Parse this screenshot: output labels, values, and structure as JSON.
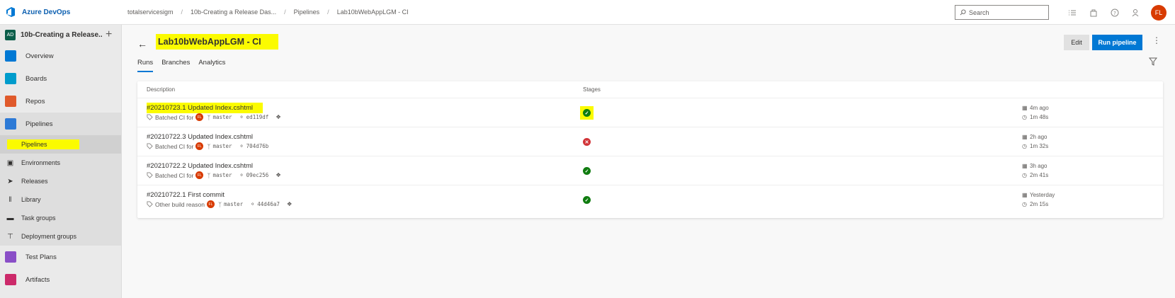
{
  "topbar": {
    "brand": "Azure DevOps",
    "breadcrumb": [
      "totalservicesigm",
      "10b-Creating a Release Das...",
      "Pipelines",
      "Lab10bWebAppLGM - CI"
    ],
    "search_placeholder": "Search",
    "user_initials": "FL"
  },
  "sidebar": {
    "project_badge": "AD",
    "project_name": "10b-Creating a Release...",
    "items": [
      {
        "label": "Overview",
        "color": "#0078d4"
      },
      {
        "label": "Boards",
        "color": "#009ccc"
      },
      {
        "label": "Repos",
        "color": "#e05a2b"
      },
      {
        "label": "Pipelines",
        "color": "#2d7ad6"
      }
    ],
    "sub_items": [
      "Pipelines",
      "Environments",
      "Releases",
      "Library",
      "Task groups",
      "Deployment groups"
    ],
    "bottom_items": [
      {
        "label": "Test Plans",
        "color": "#8a4fc7"
      },
      {
        "label": "Artifacts",
        "color": "#cc2a6a"
      }
    ]
  },
  "main": {
    "title": "Lab10bWebAppLGM - CI",
    "edit_label": "Edit",
    "run_label": "Run pipeline",
    "tabs": [
      "Runs",
      "Branches",
      "Analytics"
    ],
    "columns": {
      "description": "Description",
      "stages": "Stages"
    },
    "runs": [
      {
        "title": "#20210723.1 Updated Index.cshtml",
        "reason": "Batched CI for",
        "branch": "master",
        "commit": "ed119df",
        "status": "success",
        "when": "4m ago",
        "duration": "1m 48s"
      },
      {
        "title": "#20210722.3 Updated Index.cshtml",
        "reason": "Batched CI for",
        "branch": "master",
        "commit": "704d76b",
        "status": "failed",
        "when": "2h ago",
        "duration": "1m 32s"
      },
      {
        "title": "#20210722.2 Updated Index.cshtml",
        "reason": "Batched CI for",
        "branch": "master",
        "commit": "09ec256",
        "status": "success",
        "when": "3h ago",
        "duration": "2m 41s"
      },
      {
        "title": "#20210722.1 First commit",
        "reason": "Other build reason",
        "branch": "master",
        "commit": "44d46a7",
        "status": "success",
        "when": "Yesterday",
        "duration": "2m 15s"
      }
    ]
  }
}
